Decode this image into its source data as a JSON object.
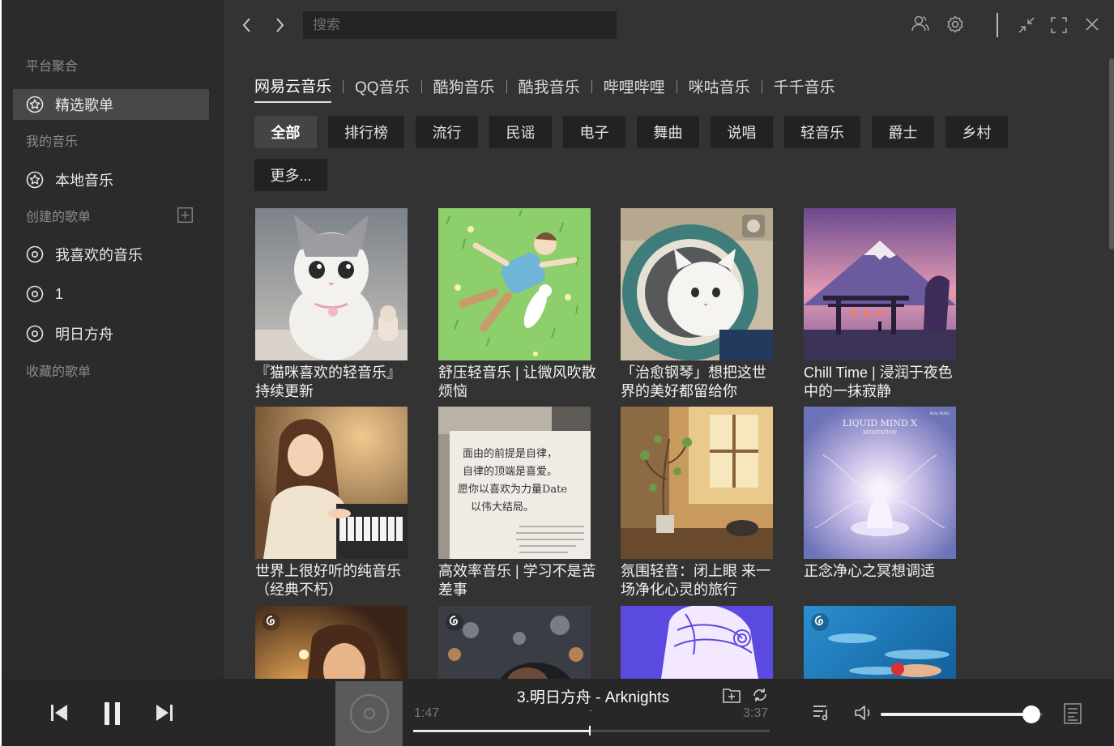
{
  "sidebar": {
    "platform_label": "平台聚合",
    "featured": "精选歌单",
    "my_music_label": "我的音乐",
    "local": "本地音乐",
    "created_label": "创建的歌单",
    "playlists": [
      "我喜欢的音乐",
      "1",
      "明日方舟"
    ],
    "collected_label": "收藏的歌单"
  },
  "toolbar": {
    "search_placeholder": "搜索"
  },
  "platforms": [
    "网易云音乐",
    "QQ音乐",
    "酷狗音乐",
    "酷我音乐",
    "哔哩哔哩",
    "咪咕音乐",
    "千千音乐"
  ],
  "categories": [
    "全部",
    "排行榜",
    "流行",
    "民谣",
    "电子",
    "舞曲",
    "说唱",
    "轻音乐",
    "爵士",
    "乡村",
    "更多..."
  ],
  "cards": [
    {
      "title": "『猫咪喜欢的轻音乐』持续更新",
      "cover": "kitten-photo"
    },
    {
      "title": "舒压轻音乐 | 让微风吹散烦恼",
      "cover": "boy-cat-grass-illustration"
    },
    {
      "title": "「治愈钢琴」想把这世界的美好都留给你",
      "cover": "cat-in-washing-machine"
    },
    {
      "title": "Chill Time | 浸润于夜色中的一抹寂静",
      "cover": "mount-fuji-torii"
    },
    {
      "title": "世界上很好听的纯音乐（经典不朽）",
      "cover": "girl-playing-piano"
    },
    {
      "title": "高效率音乐 | 学习不是苦差事",
      "cover": "handwritten-note"
    },
    {
      "title": "氛围轻音：闭上眼 来一场净化心灵的旅行",
      "cover": "sunlit-room-plant"
    },
    {
      "title": "正念净心之冥想调适",
      "cover": "meditation-cover"
    },
    {
      "title": "",
      "cover": "girl-candlelight"
    },
    {
      "title": "",
      "cover": "city-bokeh-portrait"
    },
    {
      "title": "",
      "cover": "purple-anime-illustration"
    },
    {
      "title": "",
      "cover": "swimmer-underwater"
    }
  ],
  "cover_texts": {
    "meditation_brand": "LIQUID MIND X",
    "meditation_sub": "MEDITATION",
    "meditation_corner": "REAL MUSIC",
    "note_line1": "面由的前提是自律，",
    "note_line2": "自律的顶端是喜爱。",
    "note_line3": "愿你以喜欢为力量Date",
    "note_line4": "以伟大结局。"
  },
  "player": {
    "title": "3.明日方舟 - Arknights",
    "current_time": "1:47",
    "separator": "-",
    "total_time": "3:37",
    "progress": 0.495,
    "volume": 0.93
  },
  "colors": {
    "app_bg": "#2b2b2b",
    "main_bg": "#333333",
    "player_bg": "#272727",
    "accent": "#ffffff"
  }
}
